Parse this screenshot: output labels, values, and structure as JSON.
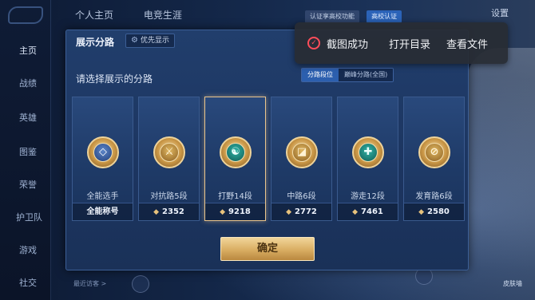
{
  "top_tabs": [
    "个人主页",
    "电竞生涯"
  ],
  "top_right": {
    "btn1": "认证享高校功能",
    "btn2": "高校认证",
    "time_label": "设置"
  },
  "sidebar": {
    "items": [
      "主页",
      "战绩",
      "英雄",
      "图鉴",
      "荣誉",
      "护卫队",
      "游戏",
      "社交"
    ]
  },
  "bottom": {
    "recent": "最近访客 >",
    "right_label": "皮肤墙"
  },
  "dialog": {
    "title": "展示分路",
    "priority_label": "优先显示",
    "subtitle": "请选择展示的分路",
    "segments": [
      "分路段位",
      "巅峰分路(全国)"
    ],
    "active_segment": 0,
    "cards": [
      {
        "name": "全能选手",
        "footer": "全能称号",
        "glyph": "◇",
        "style": "blue",
        "has_score": false
      },
      {
        "name": "对抗路5段",
        "footer": "2352",
        "glyph": "⚔",
        "style": "gold",
        "has_score": true
      },
      {
        "name": "打野14段",
        "footer": "9218",
        "glyph": "☯",
        "style": "teal",
        "has_score": true,
        "selected": true
      },
      {
        "name": "中路6段",
        "footer": "2772",
        "glyph": "◪",
        "style": "gold",
        "has_score": true
      },
      {
        "name": "游走12段",
        "footer": "7461",
        "glyph": "✚",
        "style": "teal",
        "has_score": true
      },
      {
        "name": "发育路6段",
        "footer": "2580",
        "glyph": "⊘",
        "style": "gold",
        "has_score": true
      }
    ],
    "confirm_label": "确定"
  },
  "toast": {
    "status": "截图成功",
    "open_dir": "打开目录",
    "view_file": "查看文件"
  }
}
